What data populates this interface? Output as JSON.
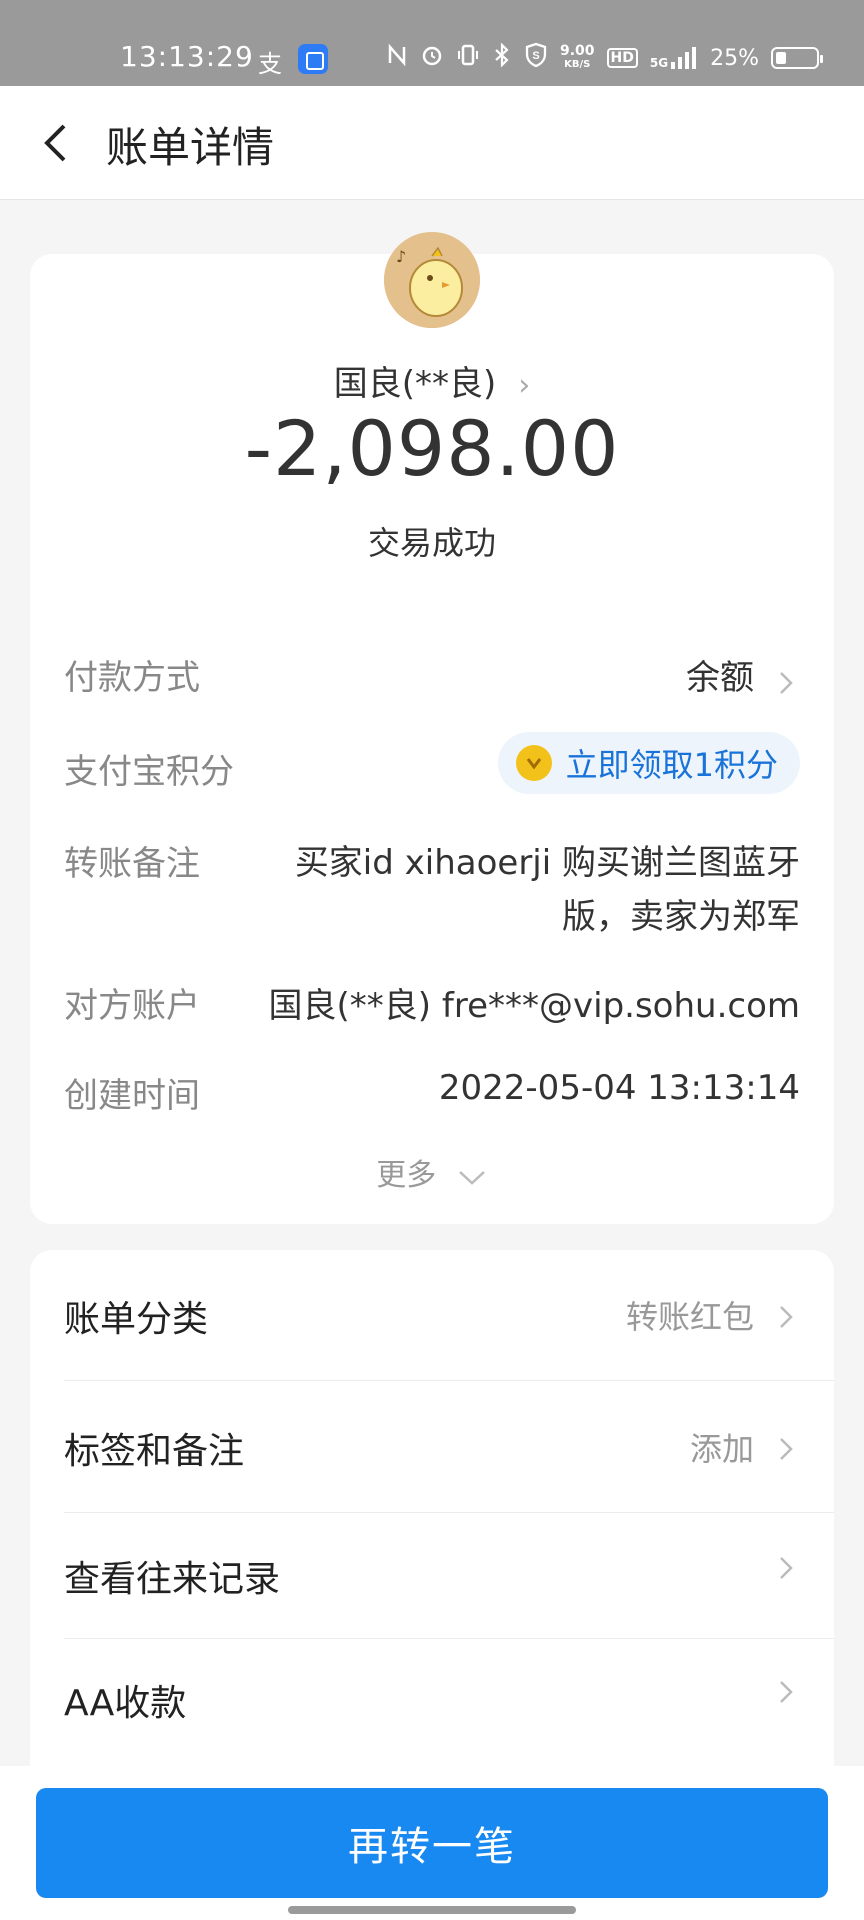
{
  "status_bar": {
    "time": "13:13:29",
    "alipay_glyph": "支",
    "net_speed_value": "9.00",
    "net_speed_unit": "KB/S",
    "hd": "HD",
    "net_type": "5G",
    "battery": "25%"
  },
  "header": {
    "title": "账单详情"
  },
  "summary": {
    "counterparty": "国良(**良)",
    "amount": "-2,098.00",
    "status": "交易成功"
  },
  "details": {
    "payment_method_label": "付款方式",
    "payment_method_value": "余额",
    "points_label": "支付宝积分",
    "points_button": "立即领取1积分",
    "note_label": "转账备注",
    "note_value_line1": "买家id xihaoerji 购买谢兰图蓝牙",
    "note_value_line2": "版，卖家为郑军",
    "account_label": "对方账户",
    "account_value": "国良(**良) fre***@vip.sohu.com",
    "created_label": "创建时间",
    "created_value": "2022-05-04 13:13:14",
    "more": "更多"
  },
  "list": {
    "category_label": "账单分类",
    "category_value": "转账红包",
    "tags_label": "标签和备注",
    "tags_value": "添加",
    "history_label": "查看往来记录",
    "aa_label": "AA收款"
  },
  "cta": {
    "label": "再转一笔"
  },
  "colors": {
    "accent": "#1989f2",
    "link": "#1a73d9",
    "coin": "#f3c21a"
  }
}
